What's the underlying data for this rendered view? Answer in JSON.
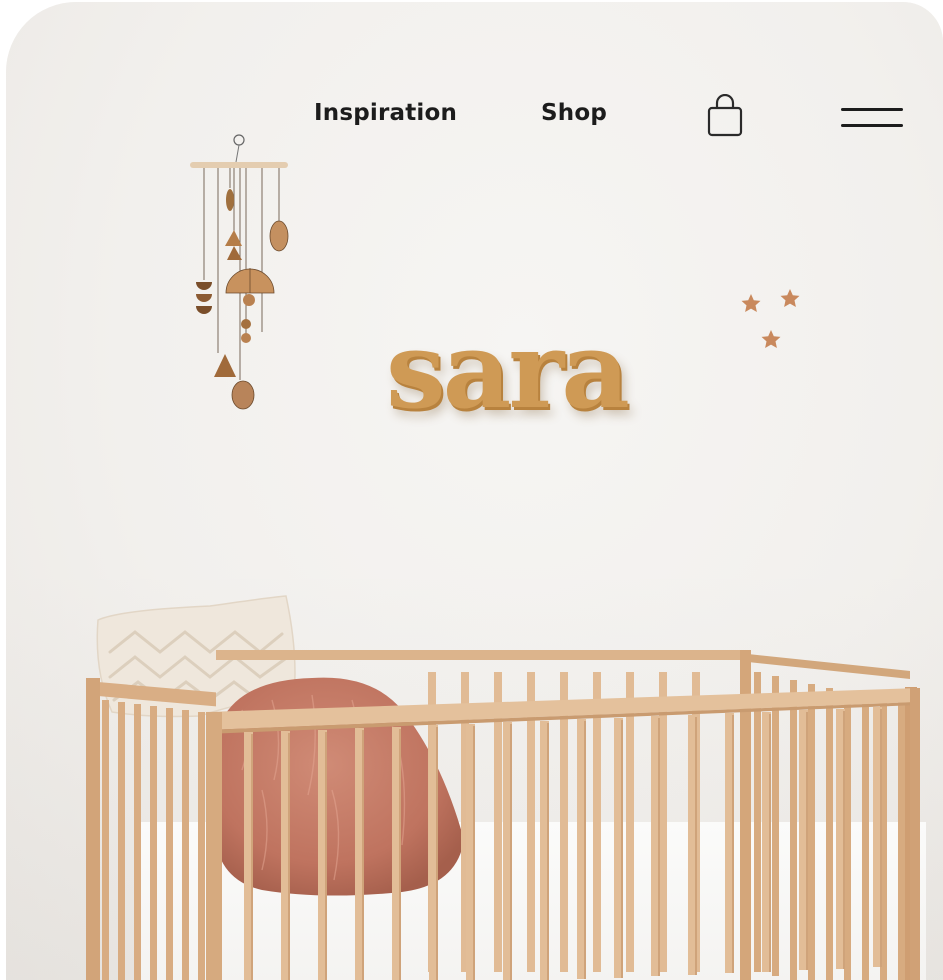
{
  "nav": {
    "links": [
      {
        "label": "Inspiration"
      },
      {
        "label": "Shop"
      }
    ],
    "icons": {
      "cart": "shopping-bag-icon",
      "menu": "hamburger-menu-icon"
    }
  },
  "hero": {
    "sign_text": "sara"
  },
  "colors": {
    "wall": "#f3f1ef",
    "sign": "#cf9a55",
    "wood": "#d9ad84",
    "pillow": "#efe7dc",
    "fluffy": "#c8806b",
    "nav_text": "#1c1c1c"
  }
}
